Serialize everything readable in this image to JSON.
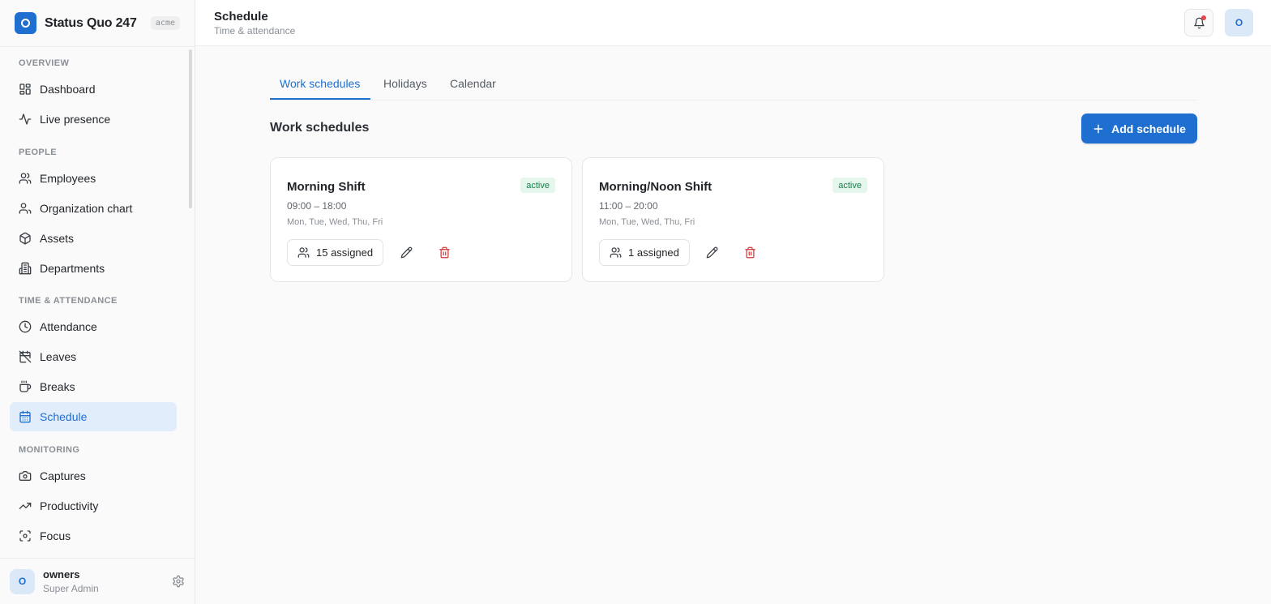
{
  "brand": {
    "name": "Status Quo 247",
    "tag": "acme",
    "accent": "#1f6fd0"
  },
  "sidebar": {
    "sections": [
      {
        "title": "OVERVIEW",
        "items": [
          {
            "label": "Dashboard",
            "icon": "dashboard-icon"
          },
          {
            "label": "Live presence",
            "icon": "activity-icon"
          }
        ]
      },
      {
        "title": "PEOPLE",
        "items": [
          {
            "label": "Employees",
            "icon": "users-icon"
          },
          {
            "label": "Organization chart",
            "icon": "org-chart-icon"
          },
          {
            "label": "Assets",
            "icon": "box-icon"
          },
          {
            "label": "Departments",
            "icon": "building-icon"
          }
        ]
      },
      {
        "title": "TIME & ATTENDANCE",
        "items": [
          {
            "label": "Attendance",
            "icon": "clock-icon"
          },
          {
            "label": "Leaves",
            "icon": "calendar-off-icon"
          },
          {
            "label": "Breaks",
            "icon": "coffee-icon"
          },
          {
            "label": "Schedule",
            "icon": "calendar-icon",
            "active": true
          }
        ]
      },
      {
        "title": "MONITORING",
        "items": [
          {
            "label": "Captures",
            "icon": "camera-icon"
          },
          {
            "label": "Productivity",
            "icon": "trending-up-icon"
          },
          {
            "label": "Focus",
            "icon": "focus-icon"
          }
        ]
      }
    ]
  },
  "user": {
    "initial": "O",
    "name": "owners",
    "role": "Super Admin"
  },
  "header": {
    "title": "Schedule",
    "subtitle": "Time & attendance",
    "avatar_initial": "O"
  },
  "tabs": [
    {
      "label": "Work schedules",
      "active": true
    },
    {
      "label": "Holidays"
    },
    {
      "label": "Calendar"
    }
  ],
  "main": {
    "section_title": "Work schedules",
    "add_button": "Add schedule"
  },
  "schedules": [
    {
      "name": "Morning Shift",
      "status": "active",
      "time": "09:00 – 18:00",
      "days": "Mon, Tue, Wed, Thu, Fri",
      "assigned": "15 assigned"
    },
    {
      "name": "Morning/Noon Shift",
      "status": "active",
      "time": "11:00 – 20:00",
      "days": "Mon, Tue, Wed, Thu, Fri",
      "assigned": "1 assigned"
    }
  ]
}
